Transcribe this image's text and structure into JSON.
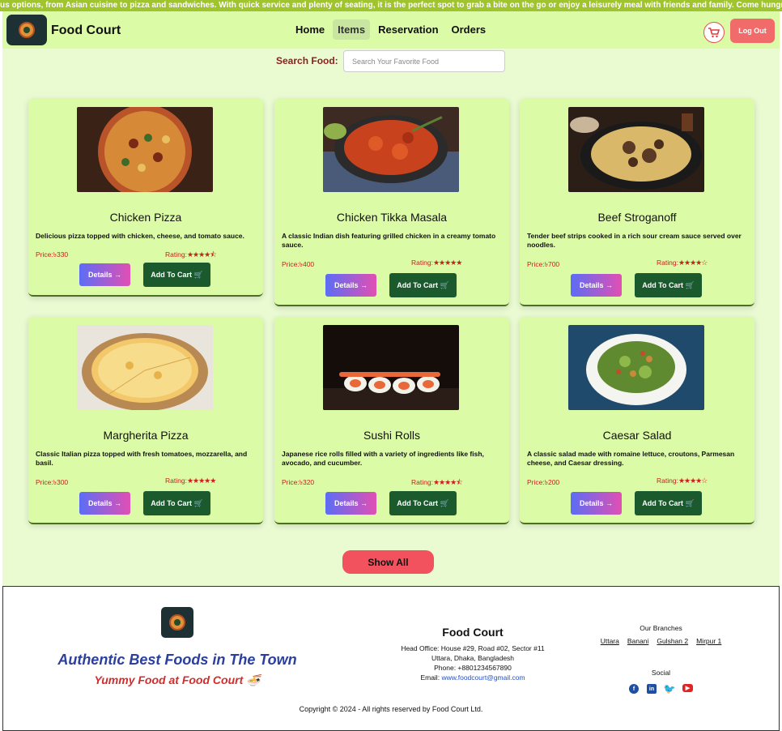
{
  "marquee": {
    "text": "us options, from Asian cuisine to pizza and sandwiches. With quick service and plenty of seating, it is the perfect spot to grab a bite on the go or enjoy a leisurely meal with friends and family. Come hungry and le"
  },
  "header": {
    "brand": "Food Court",
    "nav": [
      "Home",
      "Items",
      "Reservation",
      "Orders"
    ],
    "active_nav": "Items",
    "logout": "Log Out"
  },
  "search": {
    "label": "Search Food:",
    "placeholder": "Search Your Favorite Food"
  },
  "labels": {
    "details": "Details",
    "add_to_cart": "Add To Cart",
    "price_prefix": "Price:",
    "rating_prefix": "Rating:"
  },
  "foods": [
    {
      "name": "Chicken Pizza",
      "desc": "Delicious pizza topped with chicken, cheese, and tomato sauce.",
      "price": "৳330",
      "stars": "★★★★⯪"
    },
    {
      "name": "Chicken Tikka Masala",
      "desc": "A classic Indian dish featuring grilled chicken in a creamy tomato sauce.",
      "price": "৳400",
      "stars": "★★★★★"
    },
    {
      "name": "Beef Stroganoff",
      "desc": "Tender beef strips cooked in a rich sour cream sauce served over noodles.",
      "price": "৳700",
      "stars": "★★★★☆"
    },
    {
      "name": "Margherita Pizza",
      "desc": "Classic Italian pizza topped with fresh tomatoes, mozzarella, and basil.",
      "price": "৳300",
      "stars": "★★★★★"
    },
    {
      "name": "Sushi Rolls",
      "desc": "Japanese rice rolls filled with a variety of ingredients like fish, avocado, and cucumber.",
      "price": "৳320",
      "stars": "★★★★⯪"
    },
    {
      "name": "Caesar Salad",
      "desc": "A classic salad made with romaine lettuce, croutons, Parmesan cheese, and Caesar dressing.",
      "price": "৳200",
      "stars": "★★★★☆"
    }
  ],
  "show_all": "Show All",
  "footer": {
    "tagline1": "Authentic Best Foods in The Town",
    "tagline2": "Yummy Food at Food Court 🍜",
    "name": "Food Court",
    "address1": "Head Office: House #29, Road #02, Sector #11",
    "address2": "Uttara, Dhaka, Bangladesh",
    "phone": "Phone: +8801234567890",
    "email_label": "Email:",
    "email": "www.foodcourt@gmail.com",
    "branches_title": "Our Branches",
    "branches": [
      "Uttara",
      "Banani",
      "Gulshan 2",
      "Mirpur 1"
    ],
    "social_title": "Social",
    "copyright": "Copyright © 2024 - All rights reserved by Food Court Ltd."
  },
  "colors": {
    "navbar": "#dcfba6",
    "page_bg": "#eafbd2",
    "accent_red": "#f2525e",
    "cart_btn": "#1b5a2c"
  }
}
